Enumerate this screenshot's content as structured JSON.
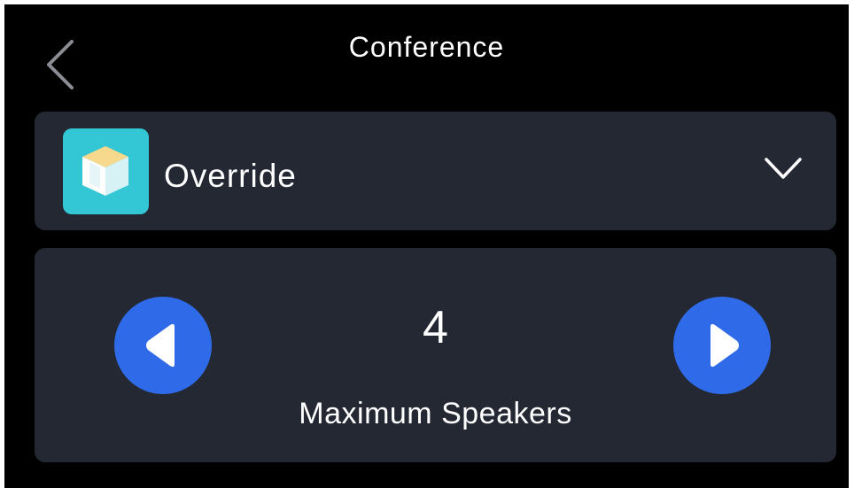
{
  "header": {
    "title": "Conference",
    "back_icon": "chevron-left-icon"
  },
  "mode": {
    "label": "Override",
    "icon": "cube-app-icon",
    "icon_color": "#33c6d4",
    "dropdown_icon": "chevron-down-icon"
  },
  "speakers": {
    "value": "4",
    "label": "Maximum Speakers",
    "decrease_icon": "triangle-left-icon",
    "increase_icon": "triangle-right-icon",
    "button_color": "#2f6be8"
  },
  "colors": {
    "background": "#000000",
    "card": "#232833",
    "text": "#ffffff"
  }
}
